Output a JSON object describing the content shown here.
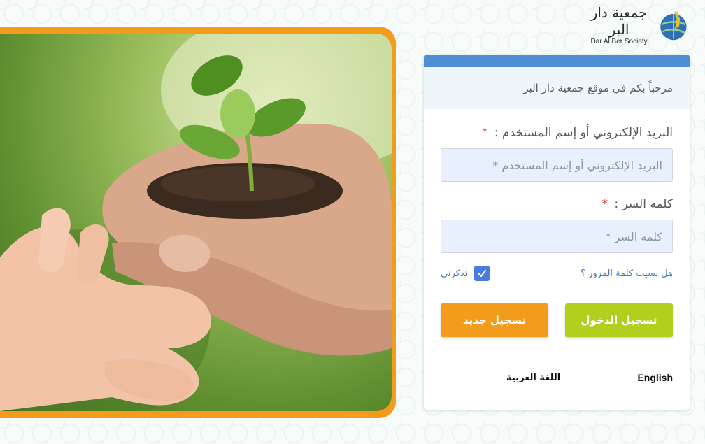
{
  "logo": {
    "arabic": "جمعية دار البر",
    "english": "Dar Al Ber Society"
  },
  "card": {
    "welcome": "مرحباً بكم في موقع جمعية دار البر",
    "email": {
      "label": "البريد الإلكتروني أو إسم المستخدم :",
      "required_mark": "*",
      "placeholder": "البريد الإلكتروني أو إسم المستخدم *"
    },
    "password": {
      "label": "كلمه السر :",
      "required_mark": "*",
      "placeholder": "كلمه السر *"
    },
    "forgot_password": "هل نسيت كلمة المرور ؟",
    "remember_me": "تذكرني",
    "login_button": "تسجيل الدخول",
    "register_button": "تسجيل جديد",
    "lang_english": "English",
    "lang_arabic": "اللغة العربية"
  },
  "colors": {
    "accent_orange": "#f39c1b",
    "accent_green": "#b3cf1e",
    "card_top_blue": "#4d8ed4"
  },
  "icons": {
    "logo_emblem": "globe-wheat-icon",
    "checkbox": "check-icon"
  }
}
